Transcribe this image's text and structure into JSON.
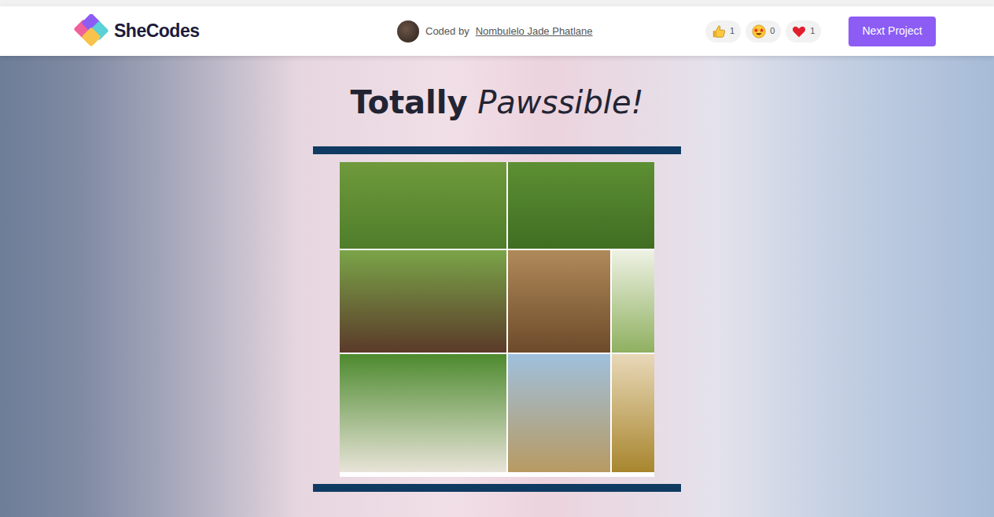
{
  "header": {
    "logo": "SheCodes",
    "coded_by": "Coded by",
    "author": "Nombulelo Jade Phatlane",
    "reactions": [
      {
        "kind": "thumbs-up",
        "count": "1"
      },
      {
        "kind": "star-eyes",
        "count": "0"
      },
      {
        "kind": "heart",
        "count": "1"
      }
    ],
    "next_button": "Next Project"
  },
  "page": {
    "title_bold": "Totally",
    "title_italic": "Pawssible!"
  }
}
